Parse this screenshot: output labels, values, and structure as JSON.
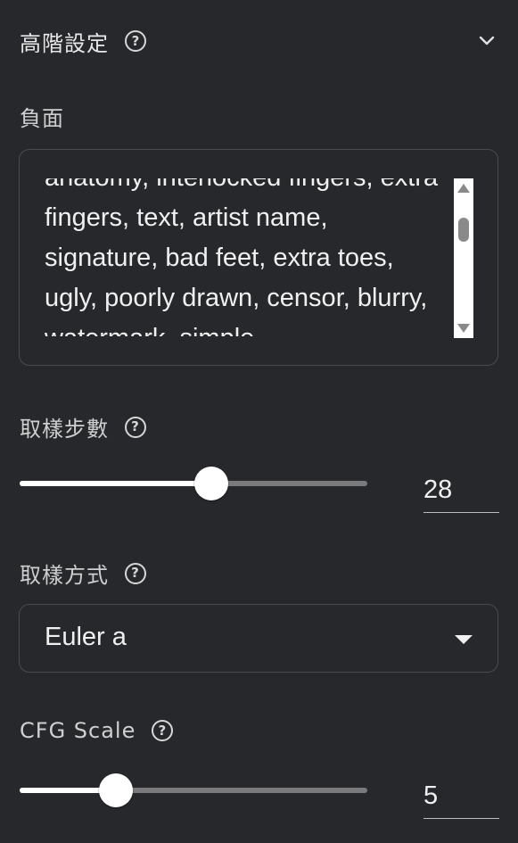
{
  "header": {
    "title": "高階設定",
    "help_icon": "help-circle-icon",
    "collapse_icon": "chevron-down-icon"
  },
  "negative": {
    "label": "負面",
    "text": "anatomy, interlocked fingers, extra fingers, text, artist name, signature, bad feet, extra toes, ugly, poorly drawn, censor, blurry, watermark, simple"
  },
  "steps": {
    "label": "取樣步數",
    "value": "28",
    "fill_fraction": 0.55
  },
  "sampler": {
    "label": "取樣方式",
    "selected": "Euler a"
  },
  "cfg": {
    "label": "CFG Scale",
    "value": "5",
    "fill_fraction": 0.28
  },
  "colors": {
    "background": "#27282b",
    "border": "#4a4b4f",
    "text": "#f0f0f0",
    "track": "#7a7a7c",
    "thumb": "#ffffff"
  }
}
